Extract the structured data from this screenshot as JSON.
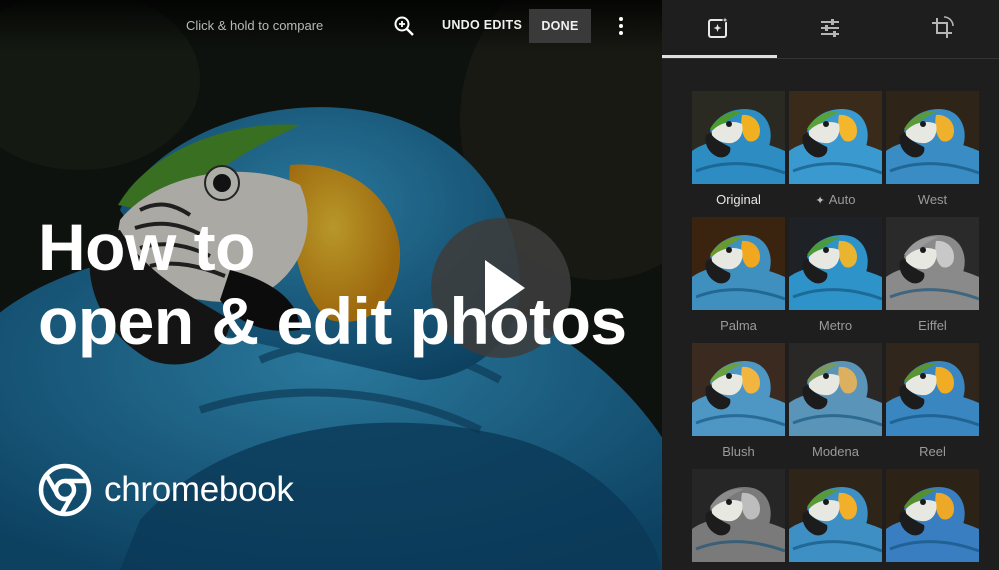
{
  "toolbar": {
    "compare_hint": "Click & hold to compare",
    "undo_label": "UNDO EDITS",
    "done_label": "DONE",
    "zoom_icon": "zoom-in-icon",
    "more_icon": "more-vert-icon"
  },
  "video": {
    "headline": "How to\nopen & edit photos",
    "brand": "chromebook"
  },
  "panel": {
    "tabs": [
      {
        "name": "filters",
        "icon": "auto-fix-icon",
        "selected": true
      },
      {
        "name": "adjust",
        "icon": "tune-icon",
        "selected": false
      },
      {
        "name": "crop",
        "icon": "crop-rotate-icon",
        "selected": false
      }
    ],
    "filters": [
      {
        "label": "Original",
        "selected": true
      },
      {
        "label": "Auto",
        "icon": "sparkle-icon"
      },
      {
        "label": "West"
      },
      {
        "label": "Palma"
      },
      {
        "label": "Metro"
      },
      {
        "label": "Eiffel"
      },
      {
        "label": "Blush"
      },
      {
        "label": "Modena"
      },
      {
        "label": "Reel"
      },
      {
        "label": ""
      },
      {
        "label": ""
      },
      {
        "label": ""
      }
    ]
  },
  "colors": {
    "panel_bg": "#1e1e1e",
    "done_bg": "#3a3a3a",
    "parrot_blue": "#2a8fc4",
    "parrot_yellow": "#f2b31e",
    "parrot_green": "#4e9a2f"
  }
}
